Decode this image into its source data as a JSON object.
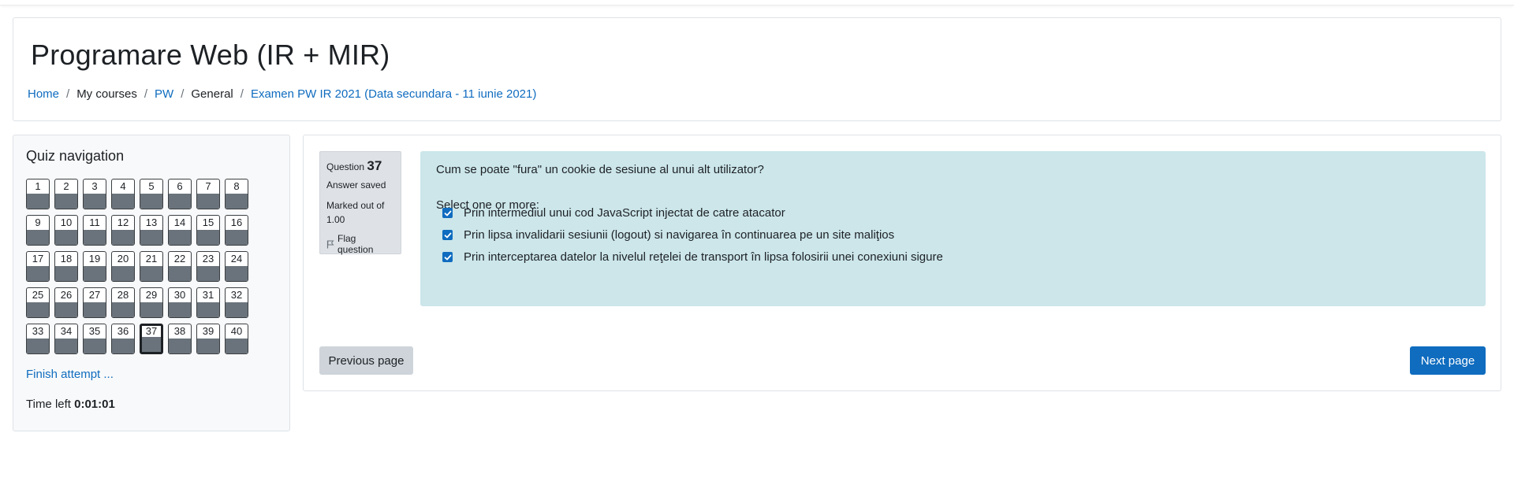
{
  "header": {
    "title": "Programare Web (IR + MIR)",
    "breadcrumb": [
      {
        "label": "Home",
        "link": true
      },
      {
        "label": "My courses",
        "link": false
      },
      {
        "label": "PW",
        "link": true
      },
      {
        "label": "General",
        "link": false
      },
      {
        "label": "Examen PW IR 2021 (Data secundara - 11 iunie 2021)",
        "link": true
      }
    ]
  },
  "quiz_nav": {
    "title": "Quiz navigation",
    "questions": [
      "1",
      "2",
      "3",
      "4",
      "5",
      "6",
      "7",
      "8",
      "9",
      "10",
      "11",
      "12",
      "13",
      "14",
      "15",
      "16",
      "17",
      "18",
      "19",
      "20",
      "21",
      "22",
      "23",
      "24",
      "25",
      "26",
      "27",
      "28",
      "29",
      "30",
      "31",
      "32",
      "33",
      "34",
      "35",
      "36",
      "37",
      "38",
      "39",
      "40"
    ],
    "current": "37",
    "finish_label": "Finish attempt ...",
    "time_label": "Time left",
    "time_value": "0:01:01"
  },
  "question": {
    "label": "Question",
    "number": "37",
    "state": "Answer saved",
    "grade": "Marked out of 1.00",
    "flag_label": "Flag question",
    "text": "Cum se poate \"fura\" un cookie de sesiune al unui alt utilizator?",
    "prompt": "Select one or more:",
    "answers": [
      {
        "label": "Prin intermediul unui cod JavaScript injectat de catre atacator",
        "checked": true
      },
      {
        "label": "Prin lipsa invalidarii sesiunii (logout) si navigarea în continuarea pe un site maliţios",
        "checked": true
      },
      {
        "label": "Prin interceptarea datelor la nivelul reţelei de transport în lipsa folosirii unei conexiuni sigure",
        "checked": true
      }
    ]
  },
  "buttons": {
    "prev": "Previous page",
    "next": "Next page"
  },
  "colors": {
    "link": "#0f6cbf",
    "formulation_bg": "#cce6ea",
    "primary": "#0f6cbf"
  }
}
